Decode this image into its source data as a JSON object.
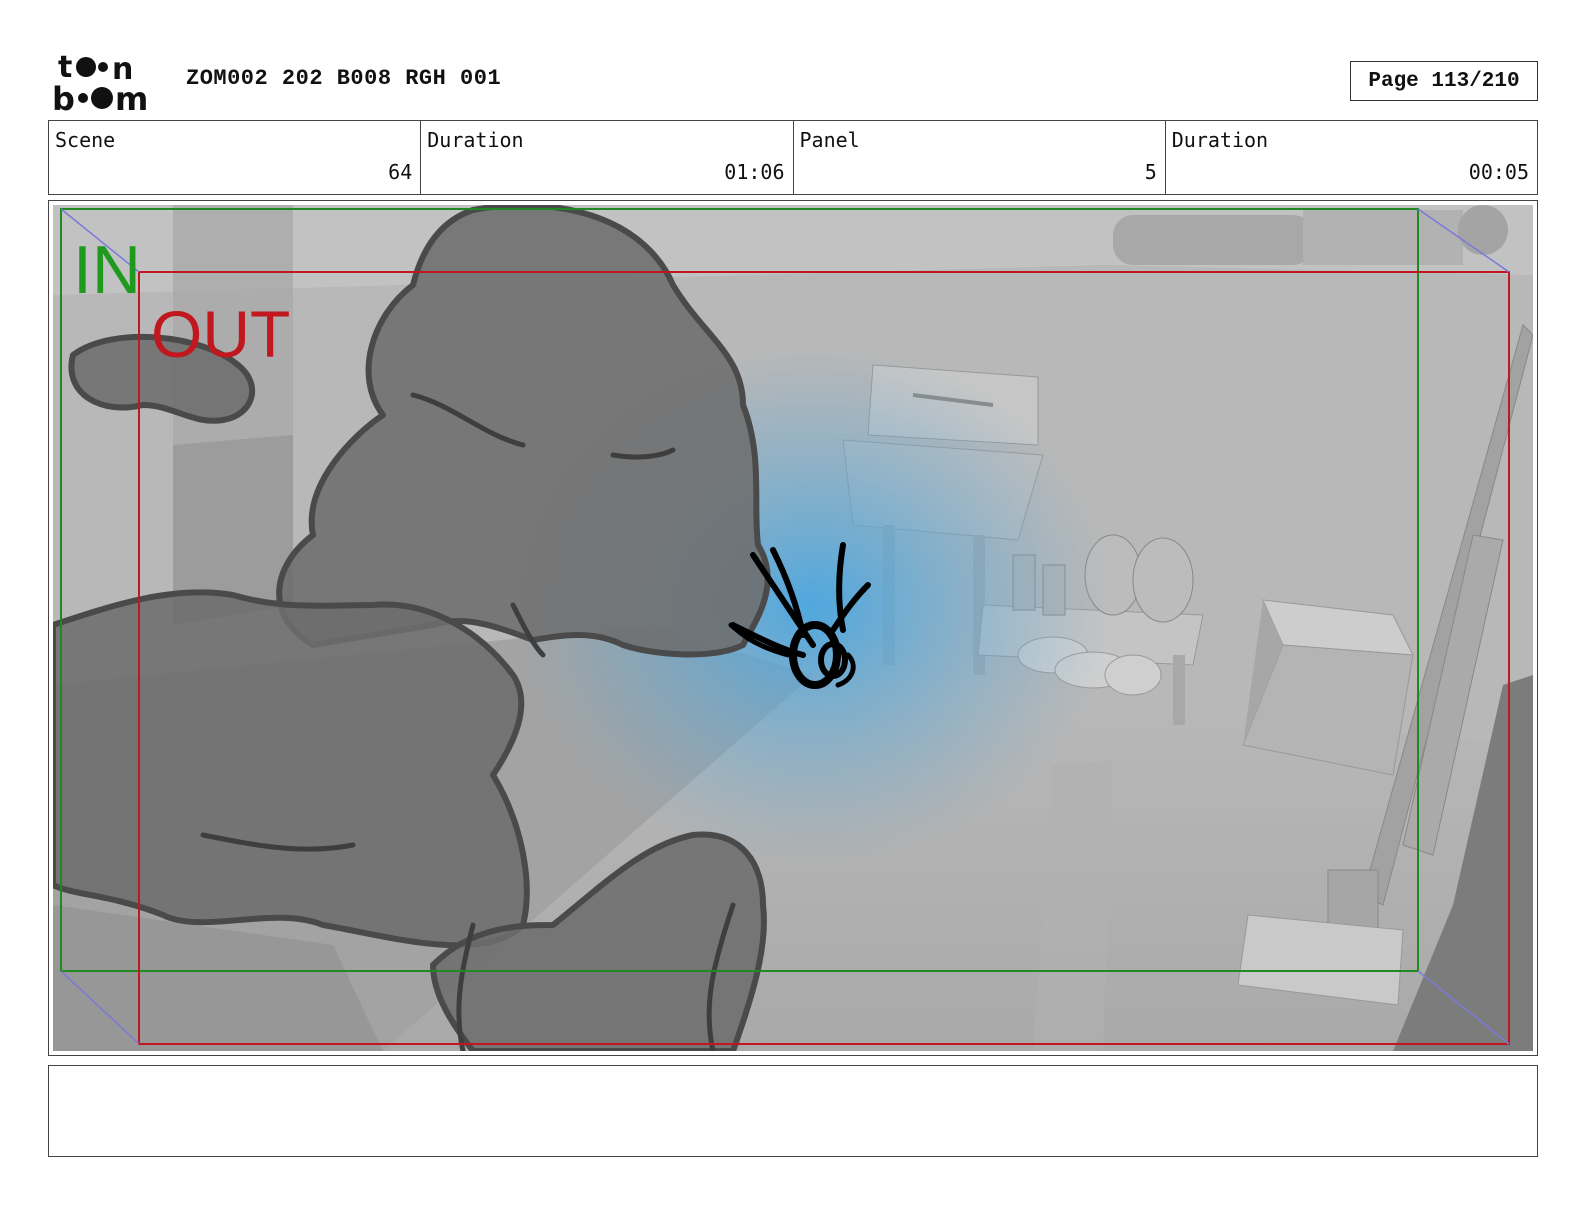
{
  "header": {
    "logo_text": "toon boom",
    "title": "ZOM002 202 B008 RGH 001",
    "page": "Page 113/210"
  },
  "info": [
    {
      "label": "Scene",
      "value": "64"
    },
    {
      "label": "Duration",
      "value": "01:06"
    },
    {
      "label": "Panel",
      "value": "5"
    },
    {
      "label": "Duration",
      "value": "00:05"
    }
  ],
  "frame": {
    "in_label": "IN",
    "out_label": "OUT",
    "in_color": "#1f8a1f",
    "out_color": "#c0181e",
    "highlight_color": "#4aa6e0"
  },
  "notes": ""
}
